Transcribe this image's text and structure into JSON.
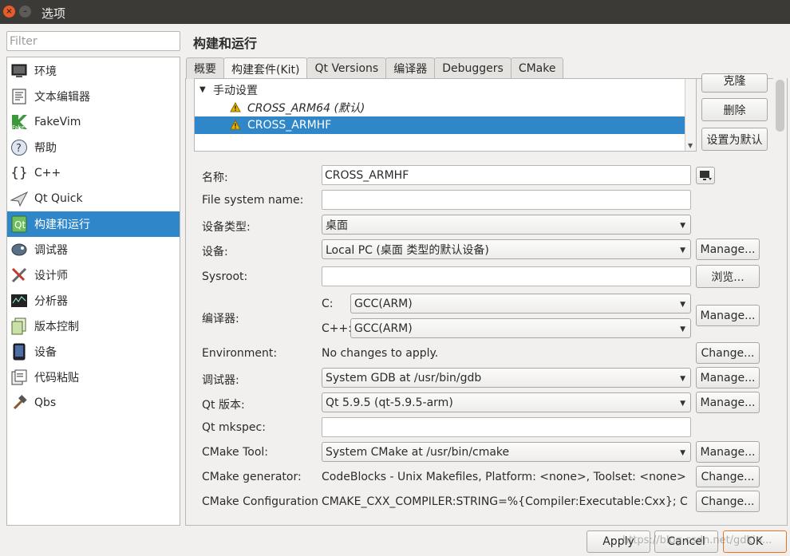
{
  "window": {
    "title": "选项",
    "close_icon": "×",
    "minimize_icon": "–"
  },
  "filter": {
    "placeholder": "Filter"
  },
  "sidebar": {
    "items": [
      {
        "label": "环境",
        "icon": "monitor-icon"
      },
      {
        "label": "文本编辑器",
        "icon": "text-editor-icon"
      },
      {
        "label": "FakeVim",
        "icon": "fakevim-icon"
      },
      {
        "label": "帮助",
        "icon": "help-icon"
      },
      {
        "label": "C++",
        "icon": "cpp-braces-icon"
      },
      {
        "label": "Qt Quick",
        "icon": "qt-quick-icon"
      },
      {
        "label": "构建和运行",
        "icon": "build-run-icon",
        "selected": true
      },
      {
        "label": "调试器",
        "icon": "debugger-icon"
      },
      {
        "label": "设计师",
        "icon": "designer-icon"
      },
      {
        "label": "分析器",
        "icon": "analyzer-icon"
      },
      {
        "label": "版本控制",
        "icon": "version-control-icon"
      },
      {
        "label": "设备",
        "icon": "device-icon"
      },
      {
        "label": "代码粘贴",
        "icon": "code-paste-icon"
      },
      {
        "label": "Qbs",
        "icon": "qbs-hammer-icon"
      }
    ]
  },
  "page": {
    "title": "构建和运行"
  },
  "tabs": [
    {
      "label": "概要"
    },
    {
      "label": "构建套件(Kit)",
      "active": true
    },
    {
      "label": "Qt Versions"
    },
    {
      "label": "编译器"
    },
    {
      "label": "Debuggers"
    },
    {
      "label": "CMake"
    }
  ],
  "kits": {
    "group": "手动设置",
    "items": [
      {
        "label": "CROSS_ARM64 (默认)",
        "italic": true
      },
      {
        "label": "CROSS_ARMHF",
        "selected": true
      }
    ],
    "buttons": {
      "clone": "克隆",
      "delete": "删除",
      "set_default": "设置为默认"
    }
  },
  "form": {
    "name_label": "名称:",
    "name_value": "CROSS_ARMHF",
    "fs_label": "File system name:",
    "fs_value": "",
    "device_type_label": "设备类型:",
    "device_type_value": "桌面",
    "device_label": "设备:",
    "device_value": "Local PC (桌面 类型的默认设备)",
    "sysroot_label": "Sysroot:",
    "sysroot_value": "",
    "compiler_label": "编译器:",
    "c_label": "C:",
    "c_value": "GCC(ARM)",
    "cxx_label": "C++:",
    "cxx_value": "GCC(ARM)",
    "env_label": "Environment:",
    "env_value": "No changes to apply.",
    "debugger_label": "调试器:",
    "debugger_value": "System GDB at /usr/bin/gdb",
    "qt_label": "Qt 版本:",
    "qt_value": "Qt 5.9.5 (qt-5.9.5-arm)",
    "mkspec_label": "Qt mkspec:",
    "mkspec_value": "",
    "cmake_tool_label": "CMake Tool:",
    "cmake_tool_value": "System CMake at /usr/bin/cmake",
    "cmake_gen_label": "CMake generator:",
    "cmake_gen_value": "CodeBlocks - Unix Makefiles, Platform: <none>, Toolset: <none>",
    "cmake_conf_label": "CMake Configuration",
    "cmake_conf_value": "CMAKE_CXX_COMPILER:STRING=%{Compiler:Executable:Cxx}; C..."
  },
  "buttons": {
    "manage": "Manage...",
    "browse": "浏览...",
    "change": "Change...",
    "apply": "Apply",
    "cancel": "Cancel",
    "ok": "OK"
  },
  "watermark": "https://blog.csdn.net/gdkin...",
  "colors": {
    "selection": "#2f87c9",
    "titlebar": "#3b3a37",
    "close": "#e95b2b",
    "warning": "#e8b400"
  }
}
